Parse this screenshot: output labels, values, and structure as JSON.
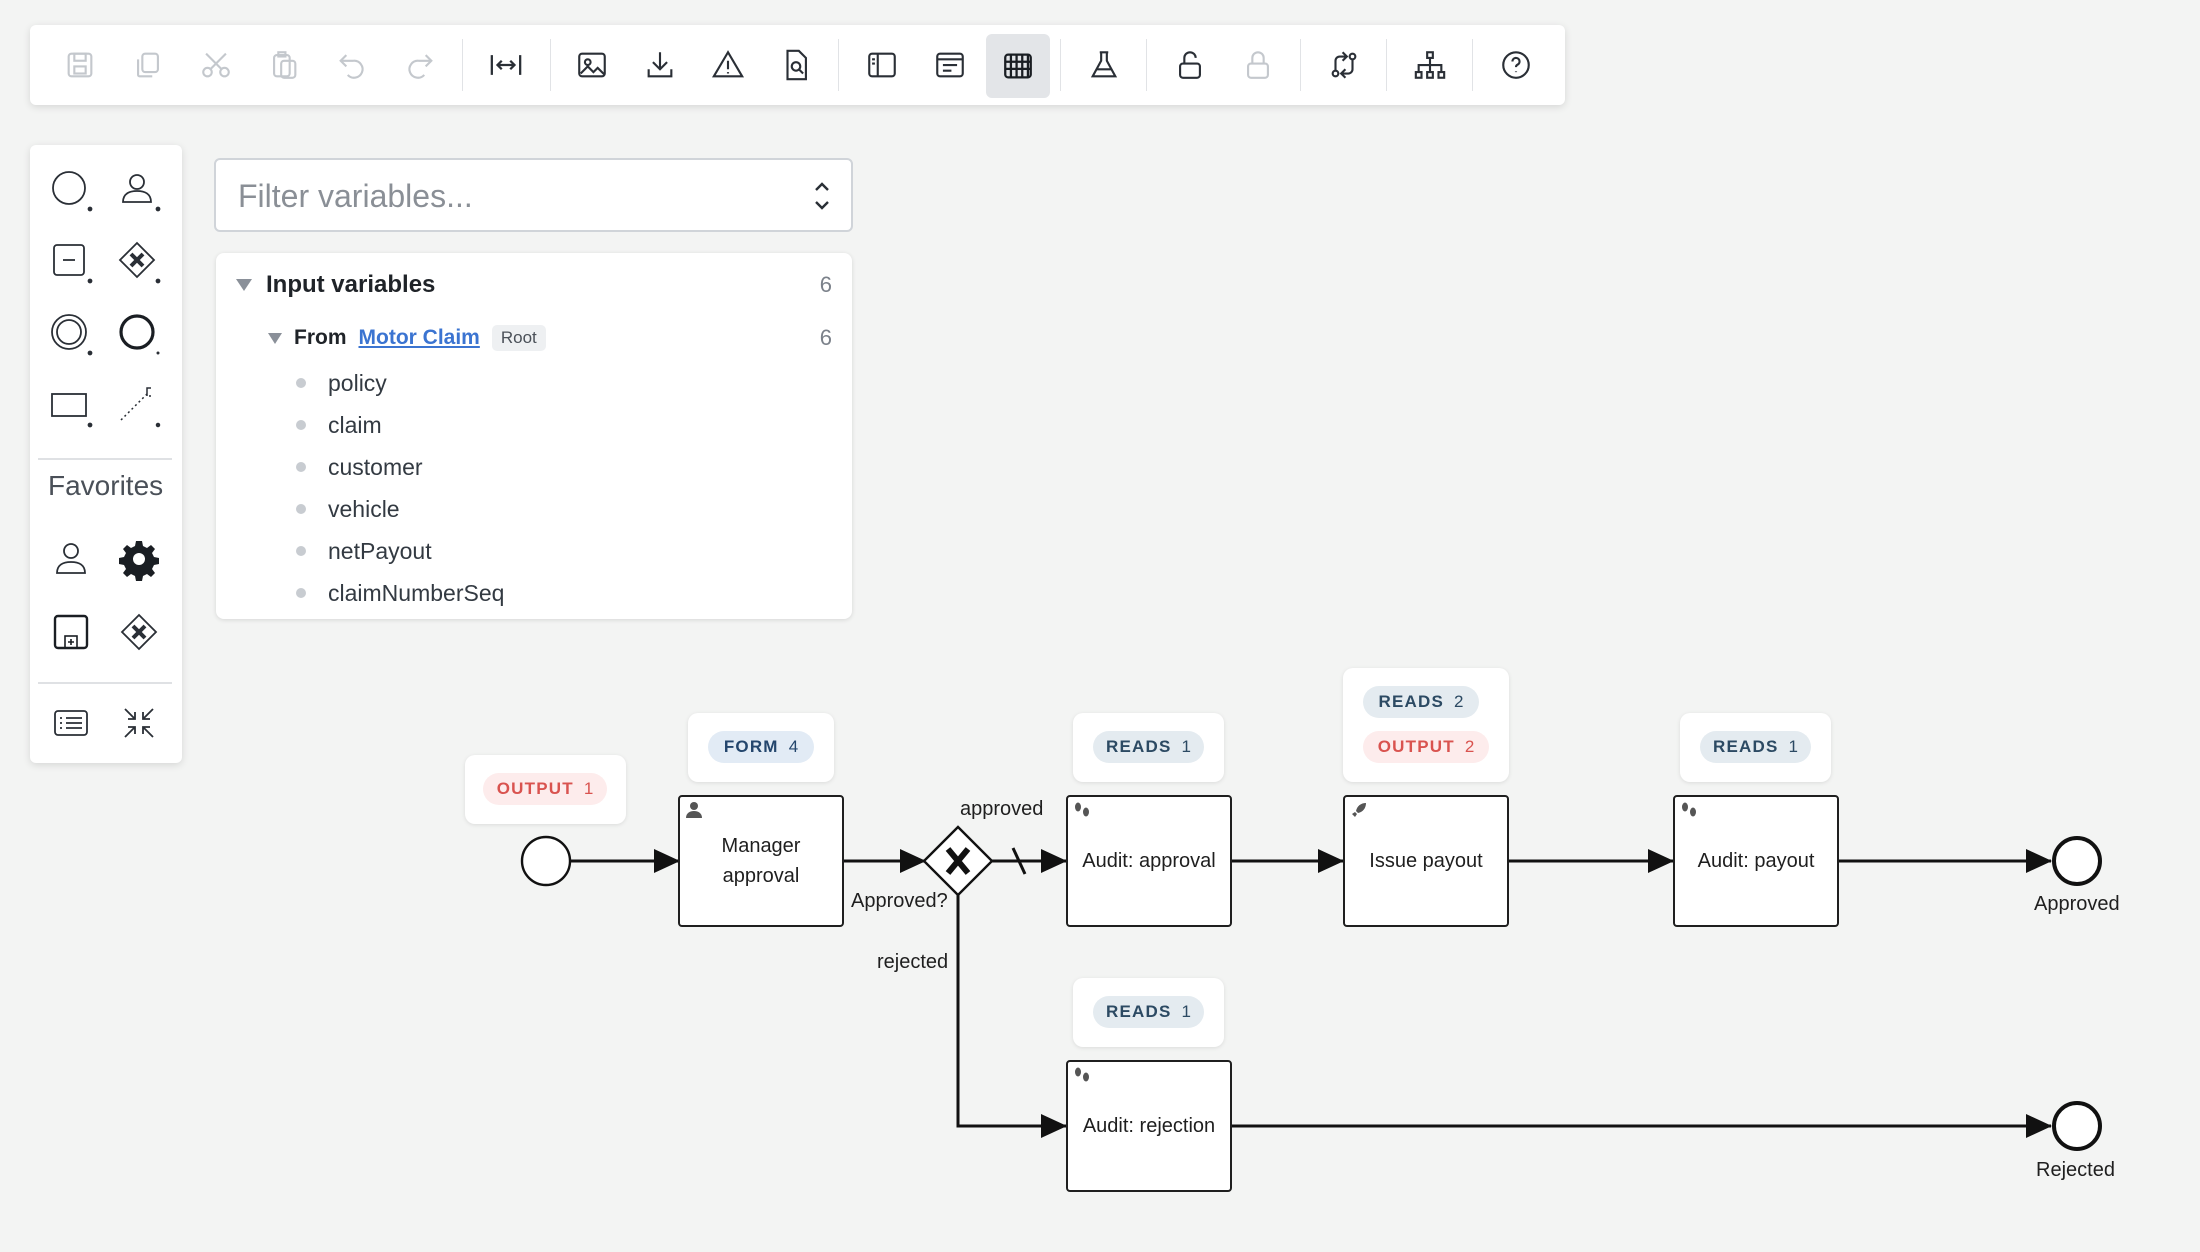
{
  "toolbar": {
    "buttons": [
      {
        "icon": "save-icon",
        "enabled": false
      },
      {
        "icon": "copy-icon",
        "enabled": false
      },
      {
        "icon": "cut-icon",
        "enabled": false
      },
      {
        "icon": "paste-icon",
        "enabled": false
      },
      {
        "icon": "undo-icon",
        "enabled": false
      },
      {
        "icon": "redo-icon",
        "enabled": false
      },
      {
        "icon": "fit-width-icon",
        "enabled": true
      },
      {
        "icon": "export-image-icon",
        "enabled": true
      },
      {
        "icon": "download-icon",
        "enabled": true
      },
      {
        "icon": "warning-icon",
        "enabled": true
      },
      {
        "icon": "search-document-icon",
        "enabled": true
      },
      {
        "icon": "panel-icon",
        "enabled": true
      },
      {
        "icon": "form-icon",
        "enabled": true
      },
      {
        "icon": "grid-icon",
        "enabled": true,
        "active": true
      },
      {
        "icon": "flask-icon",
        "enabled": true
      },
      {
        "icon": "unlock-icon",
        "enabled": true
      },
      {
        "icon": "lock-icon",
        "enabled": false
      },
      {
        "icon": "swap-flow-icon",
        "enabled": true
      },
      {
        "icon": "hierarchy-icon",
        "enabled": true
      },
      {
        "icon": "help-icon",
        "enabled": true
      }
    ]
  },
  "palette": {
    "favorites_title": "Favorites",
    "items": [
      "start-event-icon",
      "user-task-icon",
      "subprocess-icon",
      "gateway-icon",
      "intermediate-event-icon",
      "end-event-icon",
      "pool-icon",
      "connector-icon"
    ],
    "favorites": [
      "user-task-icon",
      "service-task-icon",
      "call-activity-icon",
      "gateway-icon"
    ],
    "bottom": [
      "list-icon",
      "collapse-icon"
    ]
  },
  "filter": {
    "placeholder": "Filter variables..."
  },
  "variables": {
    "title": "Input variables",
    "count": "6",
    "from_label": "From",
    "from_link": "Motor Claim",
    "from_badge": "Root",
    "from_count": "6",
    "items": [
      "policy",
      "claim",
      "customer",
      "vehicle",
      "netPayout",
      "claimNumberSeq"
    ]
  },
  "diagram": {
    "tasks": {
      "manager_approval": "Manager\napproval",
      "audit_approval": "Audit: approval",
      "issue_payout": "Issue payout",
      "audit_payout": "Audit: payout",
      "audit_rejection": "Audit: rejection"
    },
    "badges": {
      "start_output": {
        "label": "OUTPUT",
        "count": "1"
      },
      "manager_form": {
        "label": "FORM",
        "count": "4"
      },
      "audit_approval_reads": {
        "label": "READS",
        "count": "1"
      },
      "issue_payout_reads": {
        "label": "READS",
        "count": "2"
      },
      "issue_payout_output": {
        "label": "OUTPUT",
        "count": "2"
      },
      "audit_payout_reads": {
        "label": "READS",
        "count": "1"
      },
      "audit_rejection_reads": {
        "label": "READS",
        "count": "1"
      }
    },
    "labels": {
      "approved_flow": "approved",
      "gateway": "Approved?",
      "rejected_flow": "rejected",
      "end_approved": "Approved",
      "end_rejected": "Rejected"
    }
  }
}
